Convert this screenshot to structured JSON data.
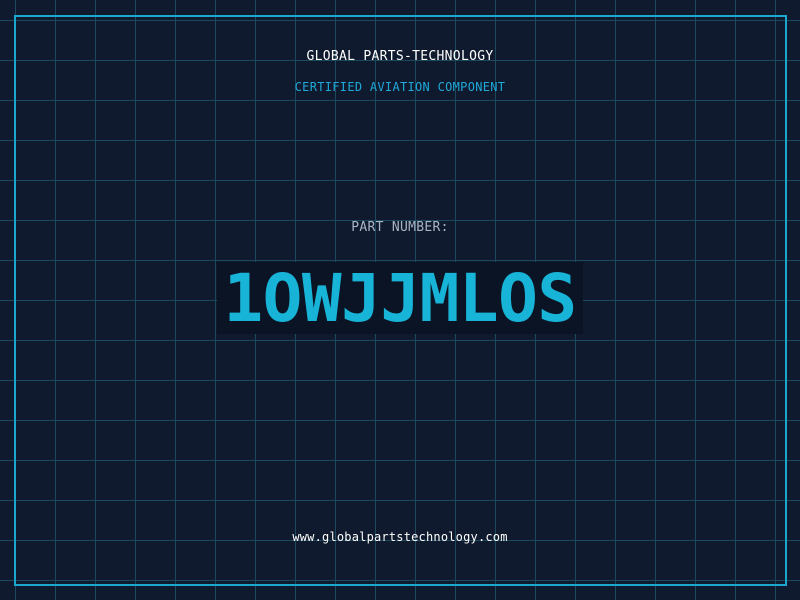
{
  "header": {
    "company": "GLOBAL PARTS-TECHNOLOGY",
    "subtitle": "CERTIFIED AVIATION COMPONENT"
  },
  "main": {
    "label": "PART NUMBER:",
    "part_number": "1OWJJMLOS"
  },
  "footer": {
    "website": "www.globalpartstechnology.com"
  },
  "colors": {
    "background": "#101a2e",
    "grid": "#1c4a5c",
    "accent": "#1aa8cf",
    "part_number": "#17b4d8",
    "label": "#a9b4c4"
  }
}
